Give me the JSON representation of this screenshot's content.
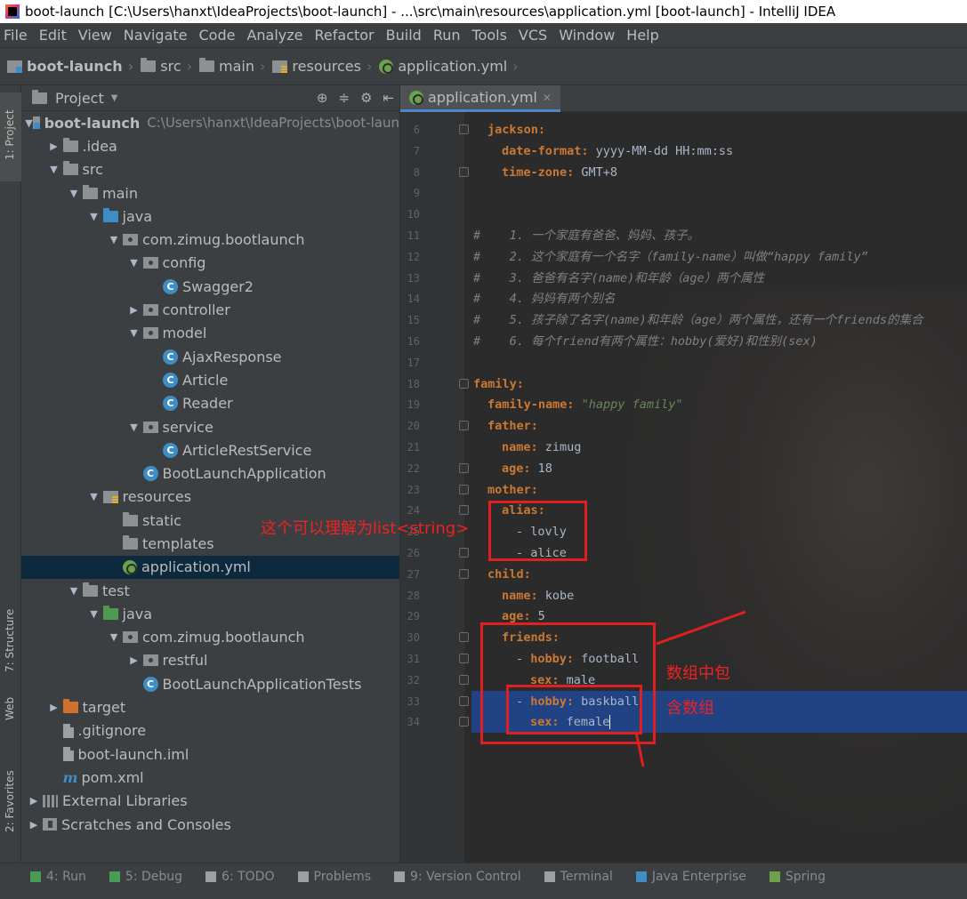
{
  "window": {
    "title": "boot-launch [C:\\Users\\hanxt\\IdeaProjects\\boot-launch] - ...\\src\\main\\resources\\application.yml [boot-launch] - IntelliJ IDEA"
  },
  "menu": [
    "File",
    "Edit",
    "View",
    "Navigate",
    "Code",
    "Analyze",
    "Refactor",
    "Build",
    "Run",
    "Tools",
    "VCS",
    "Window",
    "Help"
  ],
  "breadcrumb": [
    "boot-launch",
    "src",
    "main",
    "resources",
    "application.yml"
  ],
  "left_strip": {
    "project": "1: Project",
    "structure": "7: Structure",
    "web": "Web",
    "favorites": "2: Favorites"
  },
  "project_panel": {
    "title": "Project",
    "tree": [
      {
        "label": "boot-launch",
        "path": "C:\\Users\\hanxt\\IdeaProjects\\boot-laun",
        "depth": 0,
        "arrow": "down",
        "icon": "module",
        "bold": true
      },
      {
        "label": ".idea",
        "depth": 1,
        "arrow": "right",
        "icon": "folder"
      },
      {
        "label": "src",
        "depth": 1,
        "arrow": "down",
        "icon": "folder"
      },
      {
        "label": "main",
        "depth": 2,
        "arrow": "down",
        "icon": "folder"
      },
      {
        "label": "java",
        "depth": 3,
        "arrow": "down",
        "icon": "folder-blue"
      },
      {
        "label": "com.zimug.bootlaunch",
        "depth": 4,
        "arrow": "down",
        "icon": "package"
      },
      {
        "label": "config",
        "depth": 5,
        "arrow": "down",
        "icon": "package"
      },
      {
        "label": "Swagger2",
        "depth": 6,
        "arrow": "none",
        "icon": "class"
      },
      {
        "label": "controller",
        "depth": 5,
        "arrow": "right",
        "icon": "package"
      },
      {
        "label": "model",
        "depth": 5,
        "arrow": "down",
        "icon": "package"
      },
      {
        "label": "AjaxResponse",
        "depth": 6,
        "arrow": "none",
        "icon": "class"
      },
      {
        "label": "Article",
        "depth": 6,
        "arrow": "none",
        "icon": "class"
      },
      {
        "label": "Reader",
        "depth": 6,
        "arrow": "none",
        "icon": "class"
      },
      {
        "label": "service",
        "depth": 5,
        "arrow": "down",
        "icon": "package"
      },
      {
        "label": "ArticleRestService",
        "depth": 6,
        "arrow": "none",
        "icon": "class"
      },
      {
        "label": "BootLaunchApplication",
        "depth": 5,
        "arrow": "none",
        "icon": "class"
      },
      {
        "label": "resources",
        "depth": 3,
        "arrow": "down",
        "icon": "resources"
      },
      {
        "label": "static",
        "depth": 4,
        "arrow": "none",
        "icon": "folder"
      },
      {
        "label": "templates",
        "depth": 4,
        "arrow": "none",
        "icon": "folder"
      },
      {
        "label": "application.yml",
        "depth": 4,
        "arrow": "none",
        "icon": "yml",
        "selected": true
      },
      {
        "label": "test",
        "depth": 2,
        "arrow": "down",
        "icon": "folder"
      },
      {
        "label": "java",
        "depth": 3,
        "arrow": "down",
        "icon": "folder-green"
      },
      {
        "label": "com.zimug.bootlaunch",
        "depth": 4,
        "arrow": "down",
        "icon": "package"
      },
      {
        "label": "restful",
        "depth": 5,
        "arrow": "right",
        "icon": "package"
      },
      {
        "label": "BootLaunchApplicationTests",
        "depth": 5,
        "arrow": "none",
        "icon": "class"
      },
      {
        "label": "target",
        "depth": 1,
        "arrow": "right",
        "icon": "folder-orange"
      },
      {
        "label": ".gitignore",
        "depth": 1,
        "arrow": "none",
        "icon": "file"
      },
      {
        "label": "boot-launch.iml",
        "depth": 1,
        "arrow": "none",
        "icon": "file"
      },
      {
        "label": "pom.xml",
        "depth": 1,
        "arrow": "none",
        "icon": "maven"
      },
      {
        "label": "External Libraries",
        "depth": 0,
        "arrow": "right",
        "icon": "library"
      },
      {
        "label": "Scratches and Consoles",
        "depth": 0,
        "arrow": "right",
        "icon": "scratch"
      }
    ]
  },
  "editor": {
    "tab": "application.yml",
    "lines": [
      {
        "n": "6",
        "fold": true,
        "indent": 1,
        "parts": [
          [
            "k",
            "jackson:"
          ]
        ]
      },
      {
        "n": "7",
        "indent": 2,
        "parts": [
          [
            "k",
            "date-format: "
          ],
          [
            "v",
            "yyyy-MM-dd HH:mm:ss"
          ]
        ]
      },
      {
        "n": "8",
        "fold": true,
        "indent": 2,
        "parts": [
          [
            "k",
            "time-zone: "
          ],
          [
            "v",
            "GMT+8"
          ]
        ]
      },
      {
        "n": "9",
        "indent": 0,
        "parts": []
      },
      {
        "n": "10",
        "indent": 0,
        "parts": []
      },
      {
        "n": "11",
        "indent": 0,
        "parts": [
          [
            "c",
            "#    1. 一个家庭有爸爸、妈妈、孩子。"
          ]
        ]
      },
      {
        "n": "12",
        "indent": 0,
        "parts": [
          [
            "c",
            "#    2. 这个家庭有一个名字（family-name）叫做“happy family”"
          ]
        ]
      },
      {
        "n": "13",
        "indent": 0,
        "parts": [
          [
            "c",
            "#    3. 爸爸有名字(name)和年龄（age）两个属性"
          ]
        ]
      },
      {
        "n": "14",
        "indent": 0,
        "parts": [
          [
            "c",
            "#    4. 妈妈有两个别名"
          ]
        ]
      },
      {
        "n": "15",
        "indent": 0,
        "parts": [
          [
            "c",
            "#    5. 孩子除了名字(name)和年龄（age）两个属性，还有一个friends的集合"
          ]
        ]
      },
      {
        "n": "16",
        "indent": 0,
        "parts": [
          [
            "c",
            "#    6. 每个friend有两个属性：hobby(爱好)和性别(sex)"
          ]
        ]
      },
      {
        "n": "17",
        "indent": 0,
        "parts": []
      },
      {
        "n": "18",
        "fold": true,
        "indent": 0,
        "parts": [
          [
            "k",
            "family:"
          ]
        ]
      },
      {
        "n": "19",
        "indent": 1,
        "parts": [
          [
            "k",
            "family-name: "
          ],
          [
            "s",
            "\"happy family\""
          ]
        ]
      },
      {
        "n": "20",
        "fold": true,
        "indent": 1,
        "parts": [
          [
            "k",
            "father:"
          ]
        ]
      },
      {
        "n": "21",
        "indent": 2,
        "parts": [
          [
            "k",
            "name: "
          ],
          [
            "v",
            "zimug"
          ]
        ]
      },
      {
        "n": "22",
        "fold": true,
        "indent": 2,
        "parts": [
          [
            "k",
            "age: "
          ],
          [
            "v",
            "18"
          ]
        ]
      },
      {
        "n": "23",
        "fold": true,
        "indent": 1,
        "parts": [
          [
            "k",
            "mother:"
          ]
        ]
      },
      {
        "n": "24",
        "fold": true,
        "indent": 2,
        "parts": [
          [
            "k",
            "alias:"
          ]
        ]
      },
      {
        "n": "25",
        "indent": 3,
        "parts": [
          [
            "v",
            "- lovly"
          ]
        ]
      },
      {
        "n": "26",
        "fold": true,
        "indent": 3,
        "parts": [
          [
            "v",
            "- alice"
          ]
        ]
      },
      {
        "n": "27",
        "fold": true,
        "indent": 1,
        "parts": [
          [
            "k",
            "child:"
          ]
        ]
      },
      {
        "n": "28",
        "indent": 2,
        "parts": [
          [
            "k",
            "name: "
          ],
          [
            "v",
            "kobe"
          ]
        ]
      },
      {
        "n": "29",
        "indent": 2,
        "parts": [
          [
            "k",
            "age: "
          ],
          [
            "v",
            "5"
          ]
        ]
      },
      {
        "n": "30",
        "fold": true,
        "indent": 2,
        "parts": [
          [
            "k",
            "friends:"
          ]
        ]
      },
      {
        "n": "31",
        "fold": true,
        "indent": 3,
        "parts": [
          [
            "v",
            "- "
          ],
          [
            "k",
            "hobby: "
          ],
          [
            "v",
            "football"
          ]
        ]
      },
      {
        "n": "32",
        "fold": true,
        "indent": 4,
        "parts": [
          [
            "k",
            "sex: "
          ],
          [
            "v",
            "male"
          ]
        ]
      },
      {
        "n": "33",
        "fold": true,
        "indent": 3,
        "current": true,
        "parts": [
          [
            "v",
            "- "
          ],
          [
            "k",
            "hobby: "
          ],
          [
            "v",
            "baskball"
          ]
        ]
      },
      {
        "n": "34",
        "fold": true,
        "indent": 4,
        "current": true,
        "caret": true,
        "parts": [
          [
            "k",
            "sex: "
          ],
          [
            "v",
            "female"
          ]
        ]
      }
    ]
  },
  "annotations": {
    "list_note": "这个可以理解为list<string>",
    "array_note_1": "数组中包",
    "array_note_2": "含数组"
  },
  "bottom_tabs": [
    {
      "label": "4: Run",
      "color": "#499c54"
    },
    {
      "label": "5: Debug",
      "color": "#499c54"
    },
    {
      "label": "6: TODO",
      "color": "#9aa0a4"
    },
    {
      "label": "Problems",
      "color": "#9aa0a4"
    },
    {
      "label": "9: Version Control",
      "color": "#9aa0a4"
    },
    {
      "label": "Terminal",
      "color": "#9aa0a4"
    },
    {
      "label": "Java Enterprise",
      "color": "#3f8dc5"
    },
    {
      "label": "Spring",
      "color": "#6ba24b"
    }
  ],
  "colors": {
    "keyword": "#cc7832",
    "string": "#6a8759",
    "comment": "#808080",
    "selection": "#214283",
    "annotation": "#e02020"
  }
}
